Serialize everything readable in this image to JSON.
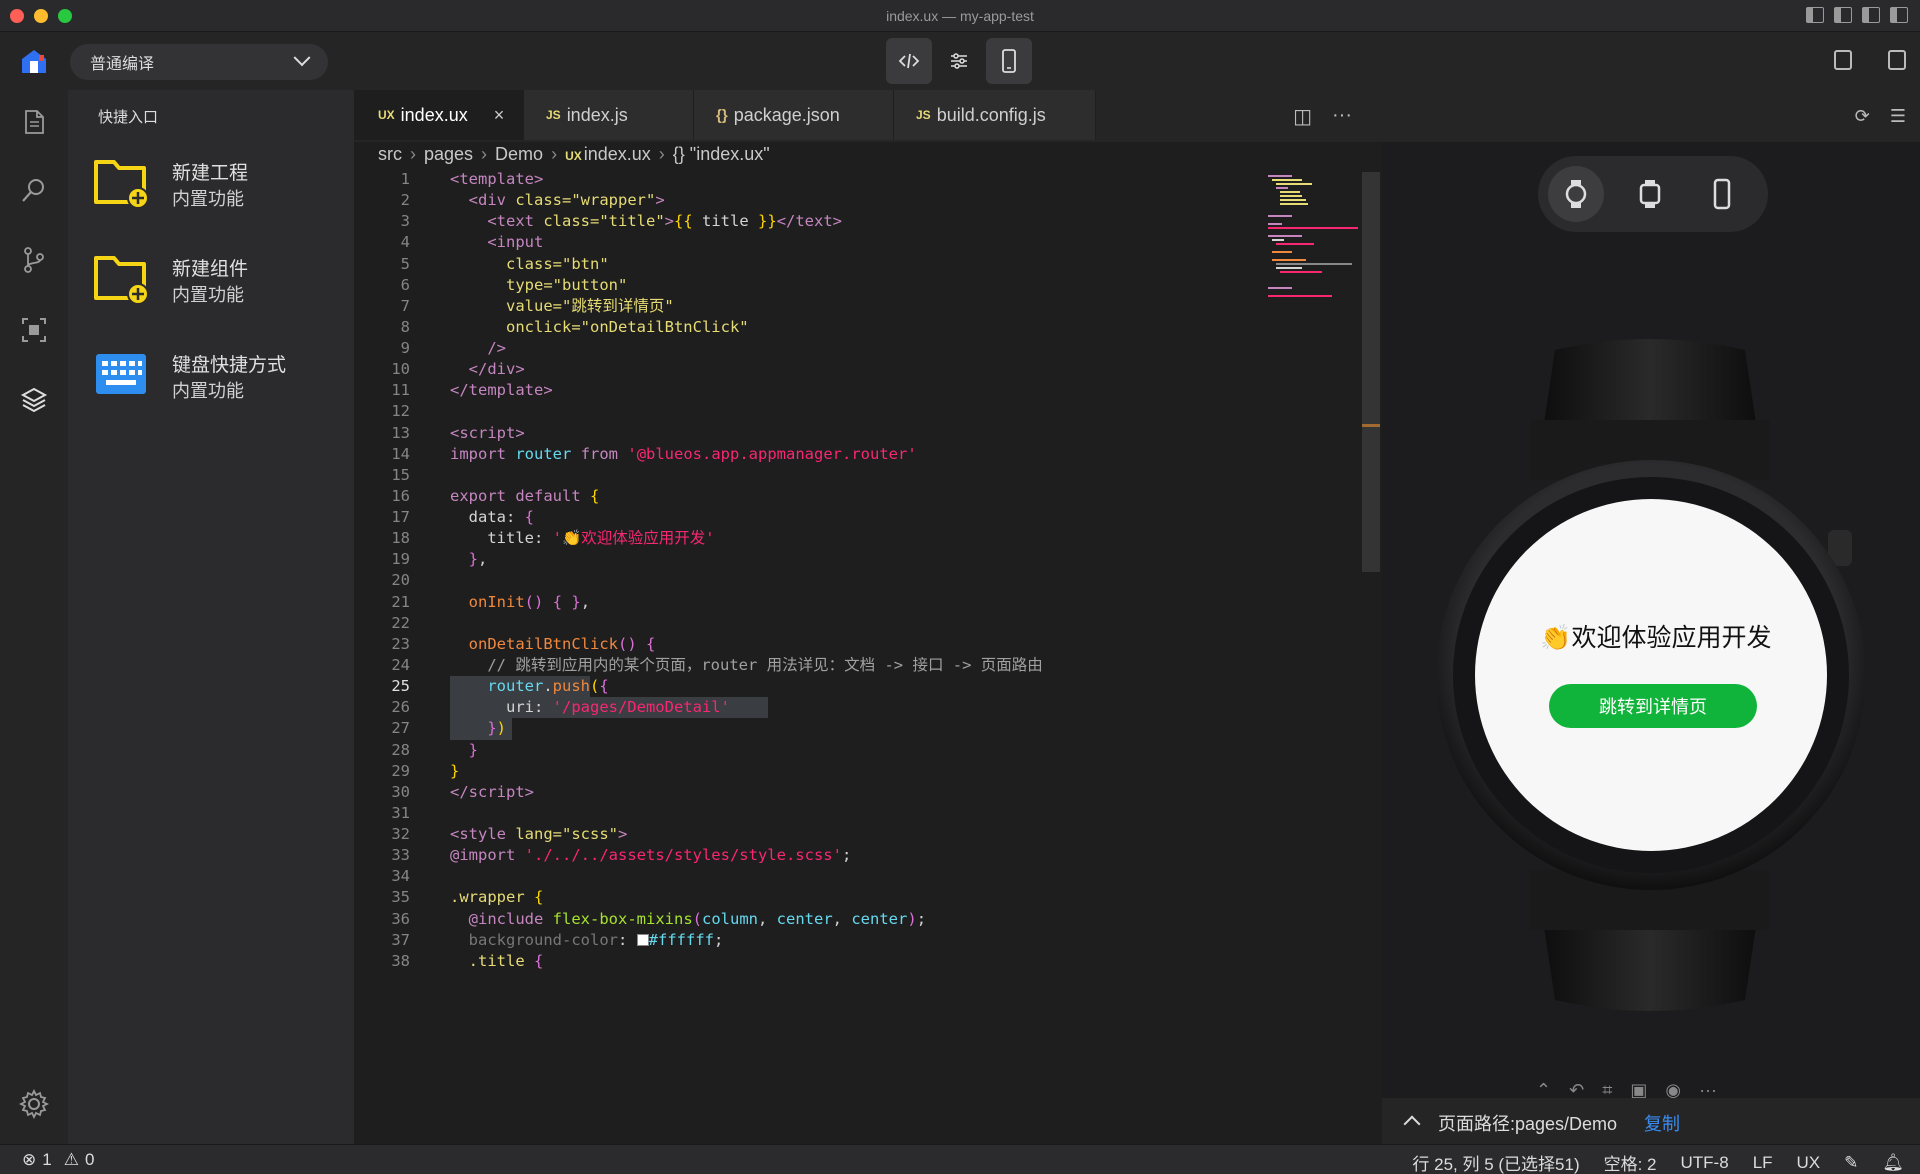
{
  "window": {
    "title": "index.ux — my-app-test"
  },
  "toolbar": {
    "compile_mode": "普通编译",
    "buttons": [
      "code-view",
      "settings-view",
      "device-view"
    ]
  },
  "side": {
    "title": "快捷入口",
    "items": [
      {
        "label": "新建工程",
        "sub": "内置功能",
        "icon": "new-project-folder-icon"
      },
      {
        "label": "新建组件",
        "sub": "内置功能",
        "icon": "new-component-folder-icon"
      },
      {
        "label": "键盘快捷方式",
        "sub": "内置功能",
        "icon": "keyboard-icon"
      }
    ]
  },
  "tabs": [
    {
      "badge": "UX",
      "label": "index.ux",
      "active": true,
      "close": "×"
    },
    {
      "badge": "JS",
      "label": "index.js"
    },
    {
      "badge": "{}",
      "label": "package.json"
    },
    {
      "badge": "JS",
      "label": "build.config.js"
    }
  ],
  "breadcrumb": [
    "src",
    "pages",
    "Demo",
    "index.ux",
    "{} \"index.ux\""
  ],
  "editor": {
    "line_numbers": [
      "1",
      "2",
      "3",
      "4",
      "5",
      "6",
      "7",
      "8",
      "9",
      "10",
      "11",
      "12",
      "13",
      "14",
      "15",
      "16",
      "17",
      "18",
      "19",
      "20",
      "21",
      "22",
      "23",
      "24",
      "25",
      "26",
      "27",
      "28",
      "29",
      "30",
      "31",
      "32",
      "33",
      "34",
      "35",
      "36",
      "37",
      "38"
    ]
  },
  "preview": {
    "watch_title": "👏欢迎体验应用开发",
    "watch_button": "跳转到详情页",
    "page_path_label": "页面路径:pages/Demo",
    "copy_label": "复制"
  },
  "status": {
    "errors": "1",
    "warnings": "0",
    "cursor": "行 25, 列 5 (已选择51)",
    "indent": "空格: 2",
    "encoding": "UTF-8",
    "eol": "LF",
    "language": "UX"
  },
  "colors": {
    "accent_green": "#11b43a",
    "link_blue": "#3b8cf0",
    "folder_yellow": "#f5d515"
  }
}
